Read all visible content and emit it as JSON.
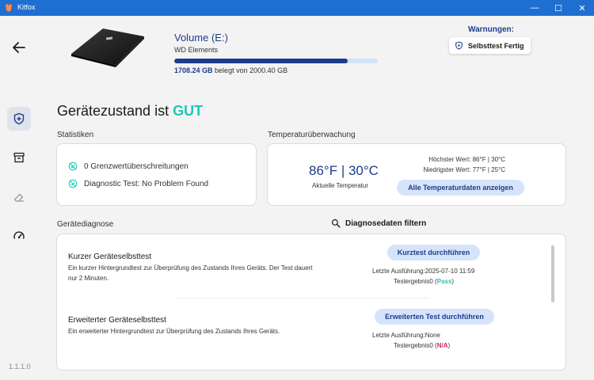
{
  "window": {
    "title": "Kitfox",
    "minimize_glyph": "—",
    "maximize_glyph": "☐",
    "close_glyph": "✕"
  },
  "sidebar": {
    "items": [
      {
        "name": "shield-icon",
        "active": true
      },
      {
        "name": "archive-icon",
        "active": false
      },
      {
        "name": "eraser-icon",
        "active": false
      },
      {
        "name": "speedometer-icon",
        "active": false
      }
    ],
    "version": "1.1.1.0"
  },
  "drive": {
    "title": "Volume (E:)",
    "model": "WD Elements",
    "used": "1708.24 GB",
    "used_suffix": " belegt von 2000.40 GB",
    "usage_fraction": 0.854
  },
  "warnings": {
    "title": "Warnungen:",
    "badge": "Selbsttest Fertig"
  },
  "health": {
    "prefix": "Gerätezustand ist ",
    "status": "GUT"
  },
  "stats": {
    "label": "Statistiken",
    "rows": [
      "0 Grenzwertüberschreitungen",
      "Diagnostic Test: No Problem Found"
    ]
  },
  "temperature": {
    "label": "Temperaturüberwachung",
    "current": "86°F | 30°C",
    "current_label": "Aktuelle Temperatur",
    "highest": "Höchster Wert: 86°F | 30°C",
    "lowest": "Niedrigster Wert: 77°F | 25°C",
    "button": "Alle Temperaturdaten anzeigen"
  },
  "diagnostics": {
    "label": "Gerätediagnose",
    "filter": "Diagnosedaten filtern",
    "tests": [
      {
        "title": "Kurzer Geräteselbsttest",
        "description": "Ein kurzer Hintergrundtest zur Überprüfung des Zustands Ihres Geräts. Der Test dauert nur 2 Minuten.",
        "button": "Kurztest durchführen",
        "last_run": "Letzte Ausführung:2025-07-10 11:59",
        "result_prefix": "Testergebnis0 (",
        "result": "Pass",
        "result_suffix": ")"
      },
      {
        "title": "Erweiterter Geräteselbsttest",
        "description": "Ein erweiterter Hintergrundtest zur Überprüfung des Zustands Ihres Geräts.",
        "button": "Erweiterten Test durchführen",
        "last_run": "Letzte Ausführung:None",
        "result_prefix": "Testergebnis0 (",
        "result": "N/A",
        "result_suffix": ")"
      }
    ]
  },
  "colors": {
    "titlebar": "#1f6fd1",
    "accent": "#1e3c8a",
    "good": "#1fc7b5",
    "na": "#d9245a"
  }
}
